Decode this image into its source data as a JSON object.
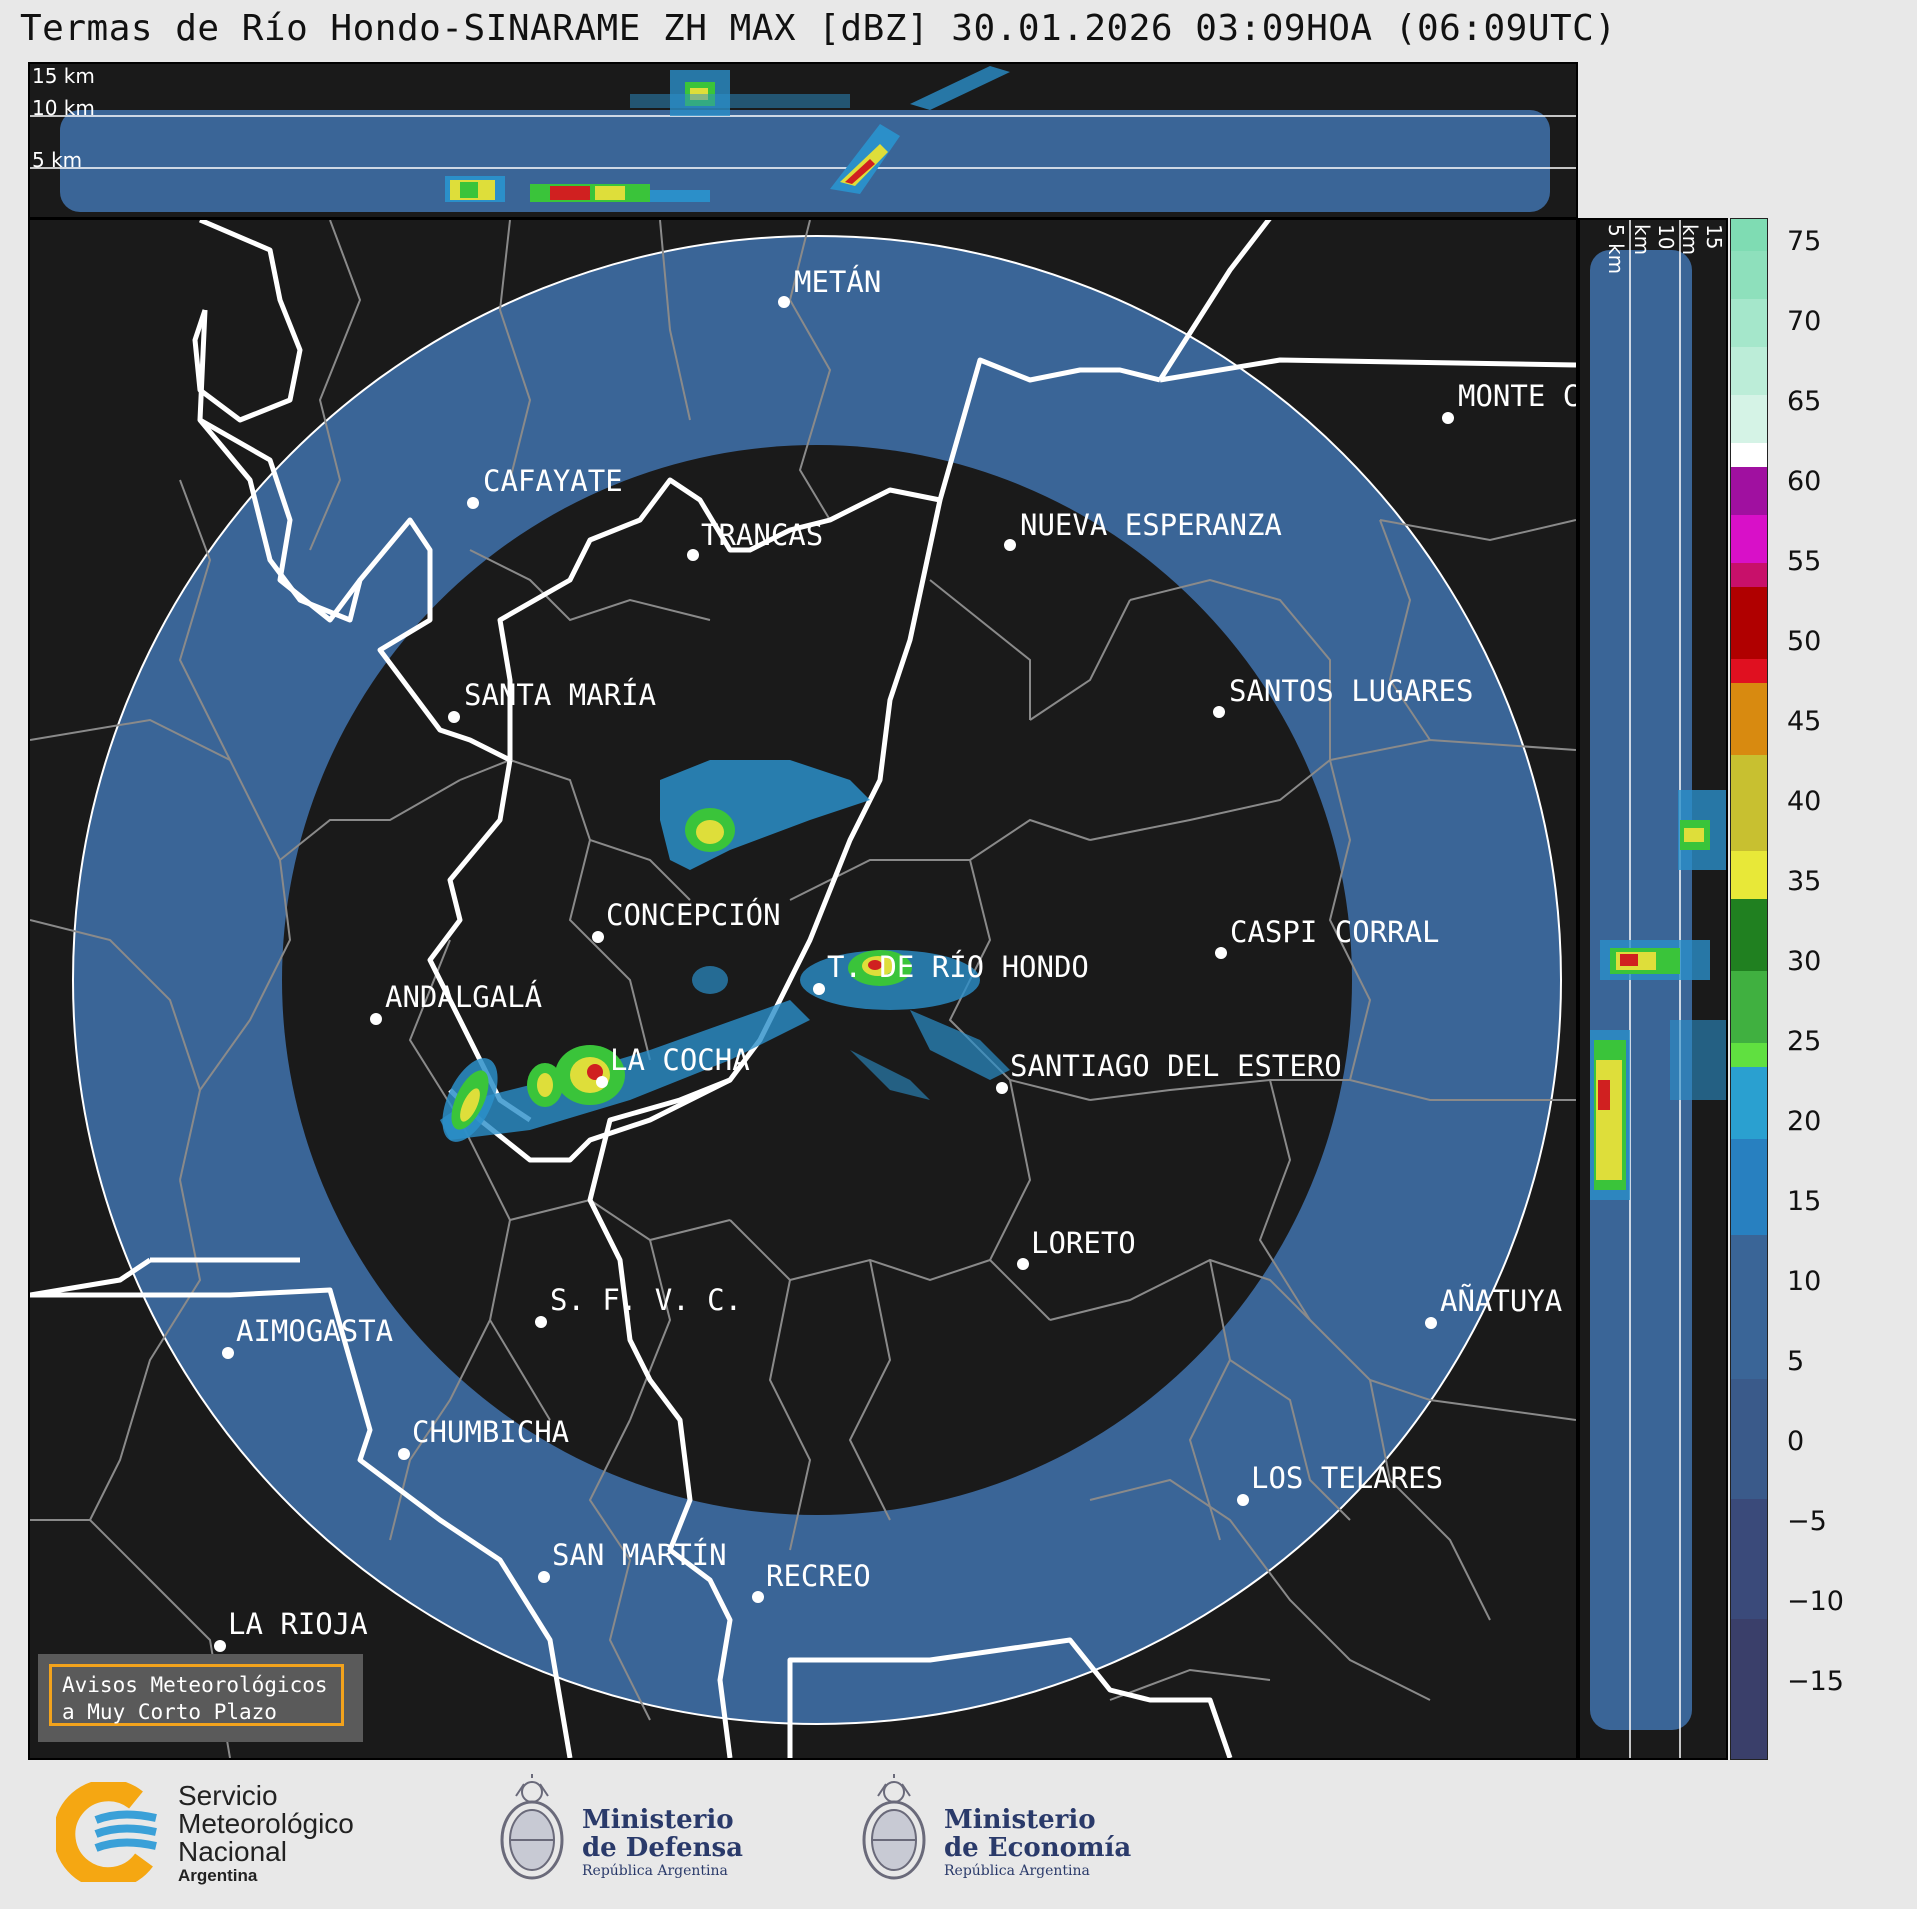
{
  "title": "Termas de Río Hondo-SINARAME ZH MAX [dBZ] 30.01.2026 03:09HOA (06:09UTC)",
  "top_panel": {
    "altitude_labels": [
      "15 km",
      "10 km",
      "5 km"
    ]
  },
  "right_panel": {
    "altitude_labels": [
      "5 km",
      "10 km",
      "15 km"
    ]
  },
  "cities": [
    {
      "name": "METÁN"
    },
    {
      "name": "MONTE C"
    },
    {
      "name": "CAFAYATE"
    },
    {
      "name": "TRANCAS"
    },
    {
      "name": "NUEVA ESPERANZA"
    },
    {
      "name": "SANTA MARÍA"
    },
    {
      "name": "SANTOS LUGARES"
    },
    {
      "name": "CONCEPCIÓN"
    },
    {
      "name": "CASPI CORRAL"
    },
    {
      "name": "T. DE RÍO HONDO"
    },
    {
      "name": "ANDALGALÁ"
    },
    {
      "name": "LA COCHA"
    },
    {
      "name": "SANTIAGO DEL ESTERO"
    },
    {
      "name": "LORETO"
    },
    {
      "name": "S. F. V. C."
    },
    {
      "name": "AÑATUYA"
    },
    {
      "name": "AIMOGASTA"
    },
    {
      "name": "CHUMBICHA"
    },
    {
      "name": "LOS TELARES"
    },
    {
      "name": "SAN MARTÍN"
    },
    {
      "name": "RECREO"
    },
    {
      "name": "LA RIOJA"
    }
  ],
  "colorbar": {
    "unit": "dBZ",
    "ticks": [
      "75",
      "70",
      "65",
      "60",
      "55",
      "50",
      "45",
      "40",
      "35",
      "30",
      "25",
      "20",
      "15",
      "10",
      "5",
      "0",
      "−5",
      "−10",
      "−15"
    ]
  },
  "warning": {
    "line1": "Avisos Meteorológicos",
    "line2": "a Muy Corto Plazo"
  },
  "logos": {
    "smn": {
      "line1": "Servicio",
      "line2": "Meteorológico",
      "line3": "Nacional",
      "line4": "Argentina"
    },
    "defensa": {
      "line1": "Ministerio",
      "line2": "de Defensa",
      "line3": "República Argentina"
    },
    "economia": {
      "line1": "Ministerio",
      "line2": "de Economía",
      "line3": "República Argentina"
    }
  },
  "colors": {
    "background": "#e8e8e8",
    "panel": "#1a1a1a",
    "radar_ring": "#3a6597",
    "border": "#ffffff",
    "dept_line": "#8a8a8a",
    "warning_border": "#f3a31c"
  }
}
